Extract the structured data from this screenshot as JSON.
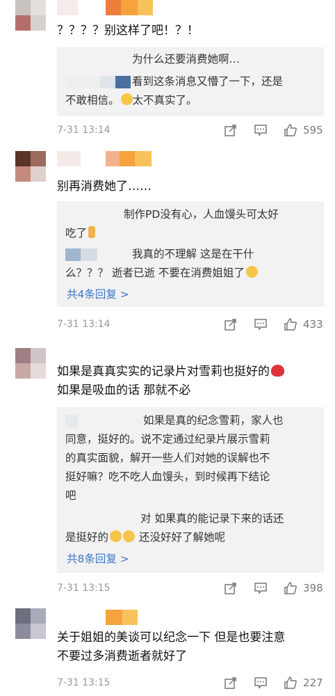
{
  "comments": [
    {
      "text": "？？？？别这样了吧！？！",
      "replies": [
        {
          "text": "为什么还要消费她啊…"
        },
        {
          "line1": "看到这条消息又懵了一下，还是",
          "line2": "不敢相信。",
          "line2_end": "太不真实了。"
        }
      ],
      "time": "7-31 13:14",
      "likes": "595"
    },
    {
      "text": "别再消费她了……",
      "replies": [
        {
          "line1": "制作PD没有心，人血馒头可太好",
          "line2": "吃了"
        },
        {
          "line1": "我真的不理解 这是在干什",
          "line2": "么？？？ 逝者已逝 不要在消费姐姐了"
        }
      ],
      "more": "共4条回复 >",
      "time": "7-31 13:14",
      "likes": "433"
    },
    {
      "text1": "如果是真真实实的记录片对雪莉也挺好的",
      "text2": "如果是吸血的话  那就不必",
      "replies": [
        {
          "line1": "如果是真的纪念雪莉，家人也",
          "line2": "同意，挺好的。说不定通过纪录片展示雪莉",
          "line3": "的真实面貌，解开一些人们对她的误解也不",
          "line4": "挺好嘛？吃不吃人血馒头，到时候再下结论",
          "line5": "吧"
        },
        {
          "line1": "对 如果真的能记录下来的话还",
          "line2": "是挺好的",
          "line2_end": "还没好好了解她呢"
        }
      ],
      "more": "共8条回复 >",
      "time": "7-31 13:15",
      "likes": "398"
    },
    {
      "text1": "关于姐姐的美谈可以纪念一下 但是也要注意",
      "text2": "不要过多消费逝者就好了",
      "time": "7-31 13:15",
      "likes": "227"
    }
  ],
  "icons": {
    "share": "share-arrow-icon",
    "comment": "comment-bubble-icon",
    "like": "thumbs-up-icon",
    "crying": "crying-emoji-icon",
    "candle": "candle-emoji-icon",
    "sleepy": "sleepy-emoji-icon",
    "heart": "red-heart-icon"
  },
  "colors": {
    "reply_bg": "#f2f2f2",
    "more_link": "#3b77c8",
    "meta": "#999999"
  }
}
